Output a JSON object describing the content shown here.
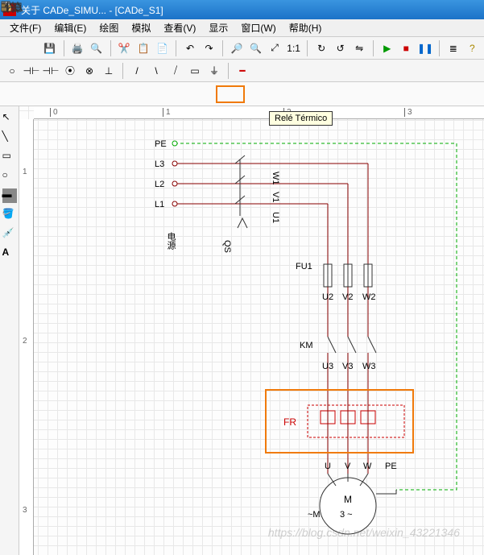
{
  "titlebar": {
    "text": "关于 CADe_SIMU... - [CADe_S1]"
  },
  "menu": {
    "file": "文件(F)",
    "edit": "编辑(E)",
    "draw": "绘图",
    "sim": "模拟",
    "view": "查看(V)",
    "display": "显示",
    "window": "窗口(W)",
    "help": "帮助(H)"
  },
  "tooltip": {
    "text": "Relé Térmico"
  },
  "ruler": {
    "t0": "0",
    "t1": "1",
    "t2": "2",
    "t3": "3",
    "l1": "1",
    "l2": "2",
    "l3": "3"
  },
  "labels": {
    "PE": "PE",
    "L3": "L3",
    "L2": "L2",
    "L1": "L1",
    "src": "电源",
    "W1": "W1",
    "V1": "V1",
    "U1": "U1",
    "QS": "QS",
    "FU1": "FU1",
    "U2": "U2",
    "V2": "V2",
    "W2": "W2",
    "KM": "KM",
    "U3": "U3",
    "V3": "V3",
    "W3": "W3",
    "FR": "FR",
    "U": "U",
    "V": "V",
    "W": "W",
    "PE2": "PE",
    "M_name": "~M",
    "M": "M",
    "Mph": "3 ~"
  },
  "watermark": "https://blog.csdn.net/weixin_43221346"
}
